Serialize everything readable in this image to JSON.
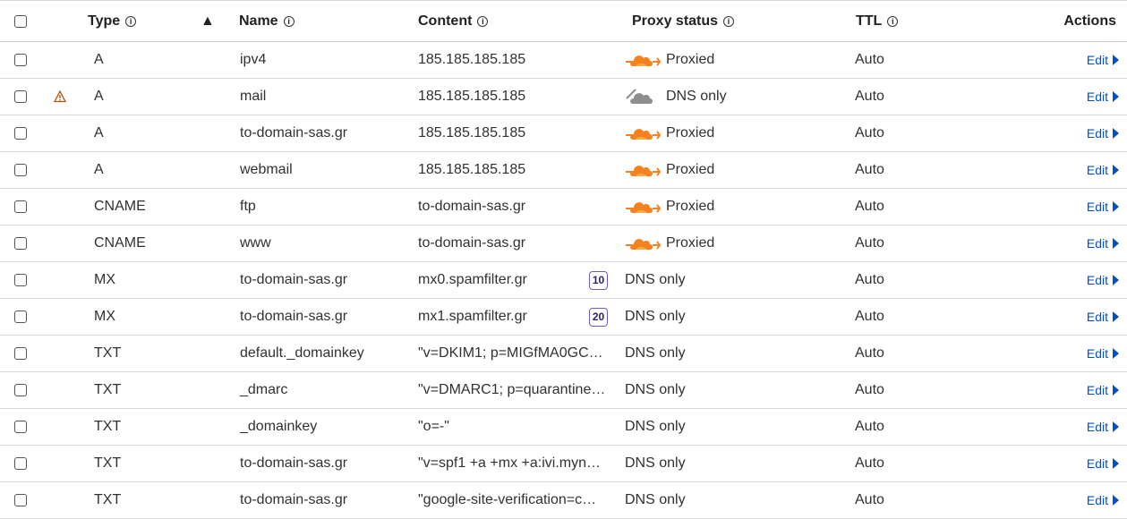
{
  "header": {
    "type": "Type",
    "name": "Name",
    "content": "Content",
    "proxy_status": "Proxy status",
    "ttl": "TTL",
    "actions": "Actions",
    "info_glyph": "i",
    "sort_glyph": "▲",
    "sort_direction": "ascending",
    "sort_column": "Type"
  },
  "colors": {
    "link": "#0051c3",
    "cloud_proxied": "#f6821f",
    "cloud_dns_only": "#8e8e8e",
    "warning": "#b45309",
    "priority_border": "#6a5fc1",
    "border": "#d9d9d9"
  },
  "rows": [
    {
      "type": "A",
      "name": "ipv4",
      "content": "185.185.185.185",
      "priority": "",
      "proxy": "Proxied",
      "proxy_icon": "cloud-proxied-icon",
      "ttl": "Auto",
      "action": "Edit",
      "warning": false
    },
    {
      "type": "A",
      "name": "mail",
      "content": "185.185.185.185",
      "priority": "",
      "proxy": "DNS only",
      "proxy_icon": "cloud-dns-only-icon",
      "ttl": "Auto",
      "action": "Edit",
      "warning": true
    },
    {
      "type": "A",
      "name": "to-domain-sas.gr",
      "content": "185.185.185.185",
      "priority": "",
      "proxy": "Proxied",
      "proxy_icon": "cloud-proxied-icon",
      "ttl": "Auto",
      "action": "Edit",
      "warning": false
    },
    {
      "type": "A",
      "name": "webmail",
      "content": "185.185.185.185",
      "priority": "",
      "proxy": "Proxied",
      "proxy_icon": "cloud-proxied-icon",
      "ttl": "Auto",
      "action": "Edit",
      "warning": false
    },
    {
      "type": "CNAME",
      "name": "ftp",
      "content": "to-domain-sas.gr",
      "priority": "",
      "proxy": "Proxied",
      "proxy_icon": "cloud-proxied-icon",
      "ttl": "Auto",
      "action": "Edit",
      "warning": false
    },
    {
      "type": "CNAME",
      "name": "www",
      "content": "to-domain-sas.gr",
      "priority": "",
      "proxy": "Proxied",
      "proxy_icon": "cloud-proxied-icon",
      "ttl": "Auto",
      "action": "Edit",
      "warning": false
    },
    {
      "type": "MX",
      "name": "to-domain-sas.gr",
      "content": "mx0.spamfilter.gr",
      "priority": "10",
      "proxy": "DNS only",
      "proxy_icon": "",
      "ttl": "Auto",
      "action": "Edit",
      "warning": false
    },
    {
      "type": "MX",
      "name": "to-domain-sas.gr",
      "content": "mx1.spamfilter.gr",
      "priority": "20",
      "proxy": "DNS only",
      "proxy_icon": "",
      "ttl": "Auto",
      "action": "Edit",
      "warning": false
    },
    {
      "type": "TXT",
      "name": "default._domainkey",
      "content": "\"v=DKIM1; p=MIGfMA0GC…",
      "priority": "",
      "proxy": "DNS only",
      "proxy_icon": "",
      "ttl": "Auto",
      "action": "Edit",
      "warning": false
    },
    {
      "type": "TXT",
      "name": "_dmarc",
      "content": "\"v=DMARC1; p=quarantine…",
      "priority": "",
      "proxy": "DNS only",
      "proxy_icon": "",
      "ttl": "Auto",
      "action": "Edit",
      "warning": false
    },
    {
      "type": "TXT",
      "name": "_domainkey",
      "content": "\"o=-\"",
      "priority": "",
      "proxy": "DNS only",
      "proxy_icon": "",
      "ttl": "Auto",
      "action": "Edit",
      "warning": false
    },
    {
      "type": "TXT",
      "name": "to-domain-sas.gr",
      "content": "\"v=spf1 +a +mx +a:ivi.myn…",
      "priority": "",
      "proxy": "DNS only",
      "proxy_icon": "",
      "ttl": "Auto",
      "action": "Edit",
      "warning": false
    },
    {
      "type": "TXT",
      "name": "to-domain-sas.gr",
      "content": "\"google-site-verification=c…",
      "priority": "",
      "proxy": "DNS only",
      "proxy_icon": "",
      "ttl": "Auto",
      "action": "Edit",
      "warning": false
    }
  ]
}
